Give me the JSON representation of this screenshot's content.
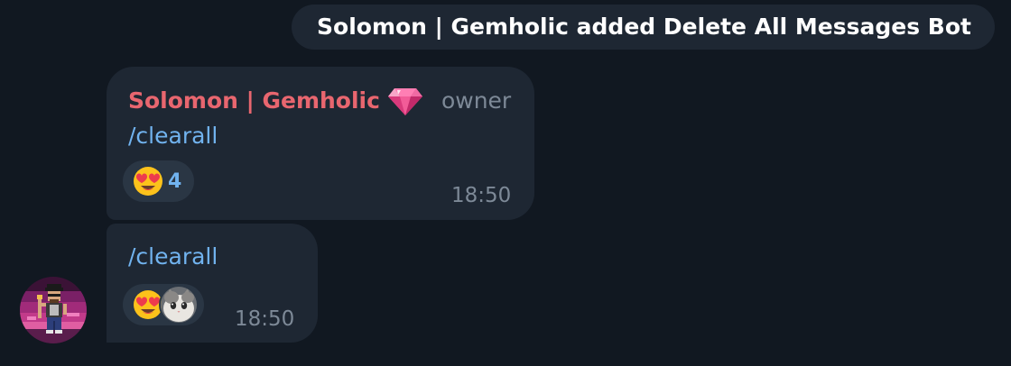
{
  "service_message": "Solomon | Gemholic added Delete All Messages Bot",
  "messages": [
    {
      "sender": "Solomon | Gemholic",
      "sender_badge_icon": "gem-icon",
      "role": "owner",
      "text": "/clearall",
      "reaction": {
        "emoji": "heart-eyes-emoji",
        "count": "4"
      },
      "time": "18:50"
    },
    {
      "text": "/clearall",
      "reaction": {
        "emoji": "heart-eyes-emoji",
        "reactor": "cat-avatar"
      },
      "time": "18:50"
    }
  ],
  "colors": {
    "background": "#111821",
    "bubble": "#1e2733",
    "sender_name": "#e8666f",
    "link": "#71b3ef",
    "muted": "#7d8997"
  }
}
